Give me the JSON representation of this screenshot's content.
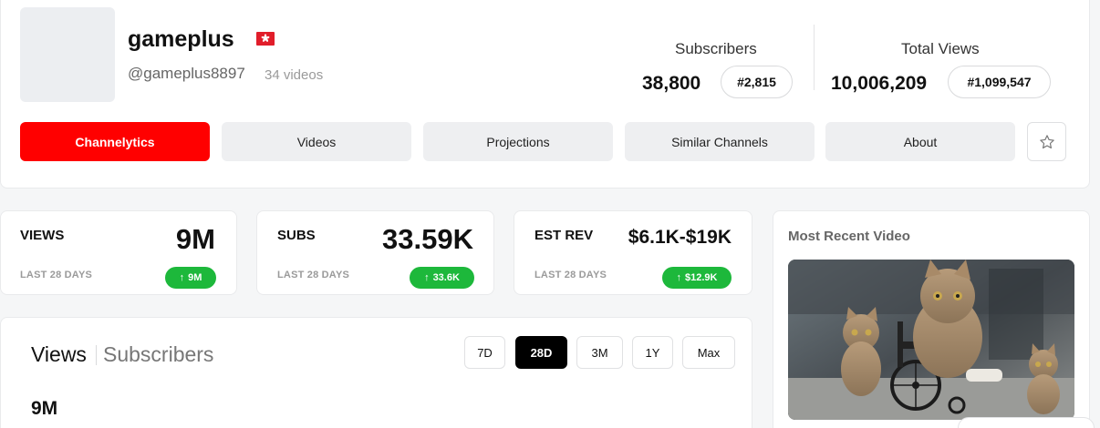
{
  "channel": {
    "name": "gameplus",
    "handle": "@gameplus8897",
    "video_count": "34 videos",
    "flag": "hong-kong-flag-icon"
  },
  "stats": {
    "subscribers_label": "Subscribers",
    "subscribers_value": "38,800",
    "subscribers_rank": "#2,815",
    "views_label": "Total Views",
    "views_value": "10,006,209",
    "views_rank": "#1,099,547"
  },
  "tabs": [
    {
      "label": "Channelytics",
      "active": true
    },
    {
      "label": "Videos",
      "active": false
    },
    {
      "label": "Projections",
      "active": false
    },
    {
      "label": "Similar Channels",
      "active": false
    },
    {
      "label": "About",
      "active": false
    }
  ],
  "metrics": [
    {
      "label": "VIEWS",
      "value": "9M",
      "period": "LAST 28 DAYS",
      "change": "9M"
    },
    {
      "label": "SUBS",
      "value": "33.59K",
      "period": "LAST 28 DAYS",
      "change": "33.6K"
    },
    {
      "label": "EST REV",
      "value": "$6.1K-$19K",
      "period": "LAST 28 DAYS",
      "change": "$12.9K"
    }
  ],
  "chart_panel": {
    "tab_views": "Views",
    "tab_subscribers": "Subscribers",
    "ranges": [
      "7D",
      "28D",
      "3M",
      "1Y",
      "Max"
    ],
    "active_range": "28D",
    "total": "9M"
  },
  "recent_video": {
    "title": "Most Recent Video"
  },
  "colors": {
    "accent": "#ff0000",
    "positive": "#1db83b"
  }
}
